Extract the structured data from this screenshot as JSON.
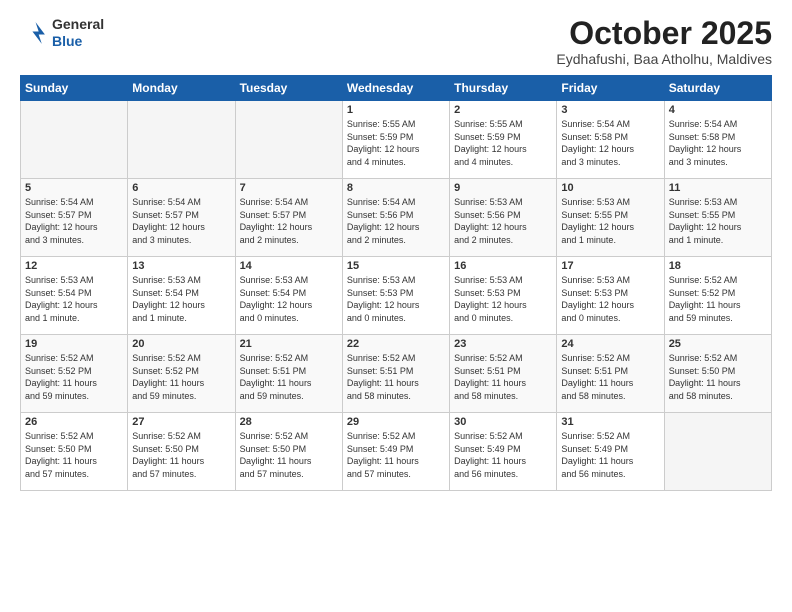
{
  "logo": {
    "general": "General",
    "blue": "Blue"
  },
  "header": {
    "month": "October 2025",
    "location": "Eydhafushi, Baa Atholhu, Maldives"
  },
  "weekdays": [
    "Sunday",
    "Monday",
    "Tuesday",
    "Wednesday",
    "Thursday",
    "Friday",
    "Saturday"
  ],
  "weeks": [
    [
      {
        "day": "",
        "info": ""
      },
      {
        "day": "",
        "info": ""
      },
      {
        "day": "",
        "info": ""
      },
      {
        "day": "1",
        "info": "Sunrise: 5:55 AM\nSunset: 5:59 PM\nDaylight: 12 hours\nand 4 minutes."
      },
      {
        "day": "2",
        "info": "Sunrise: 5:55 AM\nSunset: 5:59 PM\nDaylight: 12 hours\nand 4 minutes."
      },
      {
        "day": "3",
        "info": "Sunrise: 5:54 AM\nSunset: 5:58 PM\nDaylight: 12 hours\nand 3 minutes."
      },
      {
        "day": "4",
        "info": "Sunrise: 5:54 AM\nSunset: 5:58 PM\nDaylight: 12 hours\nand 3 minutes."
      }
    ],
    [
      {
        "day": "5",
        "info": "Sunrise: 5:54 AM\nSunset: 5:57 PM\nDaylight: 12 hours\nand 3 minutes."
      },
      {
        "day": "6",
        "info": "Sunrise: 5:54 AM\nSunset: 5:57 PM\nDaylight: 12 hours\nand 3 minutes."
      },
      {
        "day": "7",
        "info": "Sunrise: 5:54 AM\nSunset: 5:57 PM\nDaylight: 12 hours\nand 2 minutes."
      },
      {
        "day": "8",
        "info": "Sunrise: 5:54 AM\nSunset: 5:56 PM\nDaylight: 12 hours\nand 2 minutes."
      },
      {
        "day": "9",
        "info": "Sunrise: 5:53 AM\nSunset: 5:56 PM\nDaylight: 12 hours\nand 2 minutes."
      },
      {
        "day": "10",
        "info": "Sunrise: 5:53 AM\nSunset: 5:55 PM\nDaylight: 12 hours\nand 1 minute."
      },
      {
        "day": "11",
        "info": "Sunrise: 5:53 AM\nSunset: 5:55 PM\nDaylight: 12 hours\nand 1 minute."
      }
    ],
    [
      {
        "day": "12",
        "info": "Sunrise: 5:53 AM\nSunset: 5:54 PM\nDaylight: 12 hours\nand 1 minute."
      },
      {
        "day": "13",
        "info": "Sunrise: 5:53 AM\nSunset: 5:54 PM\nDaylight: 12 hours\nand 1 minute."
      },
      {
        "day": "14",
        "info": "Sunrise: 5:53 AM\nSunset: 5:54 PM\nDaylight: 12 hours\nand 0 minutes."
      },
      {
        "day": "15",
        "info": "Sunrise: 5:53 AM\nSunset: 5:53 PM\nDaylight: 12 hours\nand 0 minutes."
      },
      {
        "day": "16",
        "info": "Sunrise: 5:53 AM\nSunset: 5:53 PM\nDaylight: 12 hours\nand 0 minutes."
      },
      {
        "day": "17",
        "info": "Sunrise: 5:53 AM\nSunset: 5:53 PM\nDaylight: 12 hours\nand 0 minutes."
      },
      {
        "day": "18",
        "info": "Sunrise: 5:52 AM\nSunset: 5:52 PM\nDaylight: 11 hours\nand 59 minutes."
      }
    ],
    [
      {
        "day": "19",
        "info": "Sunrise: 5:52 AM\nSunset: 5:52 PM\nDaylight: 11 hours\nand 59 minutes."
      },
      {
        "day": "20",
        "info": "Sunrise: 5:52 AM\nSunset: 5:52 PM\nDaylight: 11 hours\nand 59 minutes."
      },
      {
        "day": "21",
        "info": "Sunrise: 5:52 AM\nSunset: 5:51 PM\nDaylight: 11 hours\nand 59 minutes."
      },
      {
        "day": "22",
        "info": "Sunrise: 5:52 AM\nSunset: 5:51 PM\nDaylight: 11 hours\nand 58 minutes."
      },
      {
        "day": "23",
        "info": "Sunrise: 5:52 AM\nSunset: 5:51 PM\nDaylight: 11 hours\nand 58 minutes."
      },
      {
        "day": "24",
        "info": "Sunrise: 5:52 AM\nSunset: 5:51 PM\nDaylight: 11 hours\nand 58 minutes."
      },
      {
        "day": "25",
        "info": "Sunrise: 5:52 AM\nSunset: 5:50 PM\nDaylight: 11 hours\nand 58 minutes."
      }
    ],
    [
      {
        "day": "26",
        "info": "Sunrise: 5:52 AM\nSunset: 5:50 PM\nDaylight: 11 hours\nand 57 minutes."
      },
      {
        "day": "27",
        "info": "Sunrise: 5:52 AM\nSunset: 5:50 PM\nDaylight: 11 hours\nand 57 minutes."
      },
      {
        "day": "28",
        "info": "Sunrise: 5:52 AM\nSunset: 5:50 PM\nDaylight: 11 hours\nand 57 minutes."
      },
      {
        "day": "29",
        "info": "Sunrise: 5:52 AM\nSunset: 5:49 PM\nDaylight: 11 hours\nand 57 minutes."
      },
      {
        "day": "30",
        "info": "Sunrise: 5:52 AM\nSunset: 5:49 PM\nDaylight: 11 hours\nand 56 minutes."
      },
      {
        "day": "31",
        "info": "Sunrise: 5:52 AM\nSunset: 5:49 PM\nDaylight: 11 hours\nand 56 minutes."
      },
      {
        "day": "",
        "info": ""
      }
    ]
  ]
}
